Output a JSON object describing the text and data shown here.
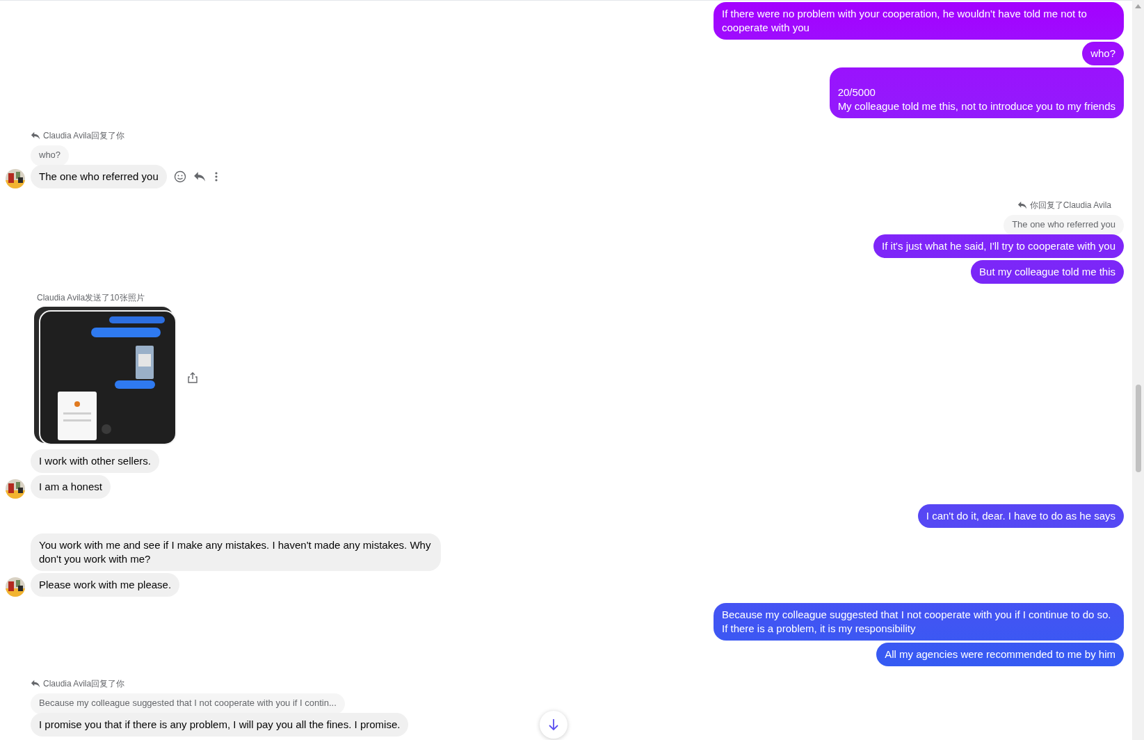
{
  "groups": [
    {
      "kind": "sent",
      "messages": [
        {
          "text": "If there were no problem with your cooperation, he wouldn't have told me not to cooperate with you"
        },
        {
          "text": "who?"
        },
        {
          "text": "20/5000\nMy colleague told me this, not to introduce you to my friends"
        }
      ]
    },
    {
      "kind": "received",
      "reply": {
        "header": "Claudia Avila回复了你",
        "quote": "who?"
      },
      "messages": [
        {
          "text": "The one who referred you",
          "avatar": true,
          "actions": true
        }
      ]
    },
    {
      "kind": "sent",
      "reply": {
        "header": "你回复了Claudia Avila",
        "quote": "The one who referred you"
      },
      "messages": [
        {
          "text": "If it's just what he said, I'll try to cooperate with you"
        },
        {
          "text": "But my colleague told me this"
        }
      ]
    },
    {
      "kind": "received",
      "caption": "Claudia Avila发送了10张照片",
      "photos": {
        "kind": "picture"
      },
      "messages": [
        {
          "text": "I work with other sellers.",
          "avatar": false,
          "actions": false
        },
        {
          "text": "I am a honest",
          "avatar": true,
          "actions": false
        }
      ]
    },
    {
      "kind": "sent",
      "messages": [
        {
          "text": "I can't do it, dear. I have to do as he says"
        }
      ]
    },
    {
      "kind": "received",
      "messages": [
        {
          "text": "You work with me and see if I make any mistakes. I haven't made any mistakes. Why don't you work with me?",
          "avatar": false,
          "actions": false
        },
        {
          "text": "Please work with me please.",
          "avatar": true,
          "actions": false
        }
      ]
    },
    {
      "kind": "sent",
      "messages": [
        {
          "text": "Because my colleague suggested that I not cooperate with you if I continue to do so. If there is a problem, it is my responsibility"
        },
        {
          "text": "All my agencies were recommended to me by him"
        }
      ]
    },
    {
      "kind": "received",
      "reply": {
        "header": "Claudia Avila回复了你",
        "quote": "Because my colleague suggested that I not cooperate with you if I contin..."
      },
      "messages": [
        {
          "text": "I promise you that if there is any problem, I will pay you all the fines. I promise.",
          "avatar": false,
          "actions": false
        }
      ]
    }
  ]
}
